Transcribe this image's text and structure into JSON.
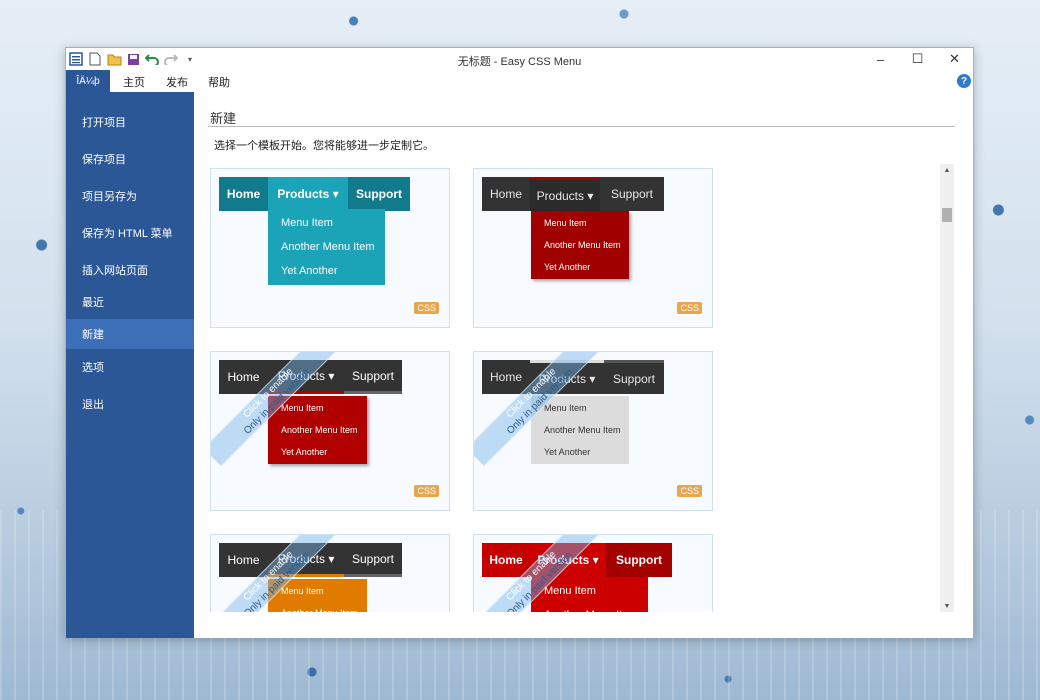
{
  "window": {
    "title": "无标题 - Easy CSS Menu",
    "controls": {
      "minimize": "–",
      "maximize": "☐",
      "close": "✕"
    }
  },
  "ribbon": {
    "file_tab": "ÎÄ¼þ",
    "tabs": [
      "主页",
      "发布",
      "帮助"
    ],
    "help": "?"
  },
  "sidebar": {
    "items": [
      {
        "label": "打开项目"
      },
      {
        "label": "保存项目"
      },
      {
        "label": "项目另存为"
      },
      {
        "label": "保存为 HTML 菜单"
      },
      {
        "label": "插入网站页面"
      },
      {
        "label": "最近"
      },
      {
        "label": "新建"
      },
      {
        "label": "选项"
      },
      {
        "label": "退出"
      }
    ],
    "active": "新建"
  },
  "main": {
    "heading": "新建",
    "subtitle": "选择一个模板开始。您将能够进一步定制它。",
    "badge": "CSS",
    "watermark": {
      "line1": "Click to enable",
      "line2": "Only in paid version"
    },
    "templates": [
      {
        "menu": {
          "home": "Home",
          "products": "Products ▾",
          "support": "Support"
        },
        "items": [
          "Menu Item",
          "Another Menu Item",
          "Yet Another"
        ],
        "colors": {
          "bar": "#117a8b",
          "active": "#1ba3b7",
          "dropdown": "#1ba3b7",
          "text": "#ffffff"
        }
      },
      {
        "menu": {
          "home": "Home",
          "products": "Products ▾",
          "support": "Support"
        },
        "items": [
          "Menu Item",
          "Another Menu Item",
          "Yet Another"
        ],
        "colors": {
          "bar": "#333333",
          "active": "#333333",
          "dropdown": "#a00000",
          "text": "#e6e6e6"
        }
      },
      {
        "menu": {
          "home": "Home",
          "products": "Products ▾",
          "support": "Support"
        },
        "items": [
          "Menu Item",
          "Another Menu Item",
          "Yet Another"
        ],
        "colors": {
          "bar": "#333333",
          "active": "#333333",
          "dropdown": "#b00000",
          "text": "#ffffff"
        }
      },
      {
        "menu": {
          "home": "Home",
          "products": "Products ▾",
          "support": "Support"
        },
        "items": [
          "Menu Item",
          "Another Menu Item",
          "Yet Another"
        ],
        "colors": {
          "bar": "#333333",
          "active": "#333333",
          "dropdown": "#dcdcdc",
          "text": "#333333"
        }
      },
      {
        "menu": {
          "home": "Home",
          "products": "Products ▾",
          "support": "Support"
        },
        "items": [
          "Menu Item",
          "Another Menu Item"
        ],
        "colors": {
          "bar": "#333333",
          "active": "#333333",
          "dropdown": "#e07b00",
          "text": "#ffffff"
        }
      },
      {
        "menu": {
          "home": "Home",
          "products": "Products ▾",
          "support": "Support"
        },
        "items": [
          "Menu Item",
          "Another Menu Item"
        ],
        "colors": {
          "bar": "#cc0000",
          "active": "#cc0000",
          "dropdown": "#cc0000",
          "text": "#ffffff"
        }
      }
    ]
  }
}
